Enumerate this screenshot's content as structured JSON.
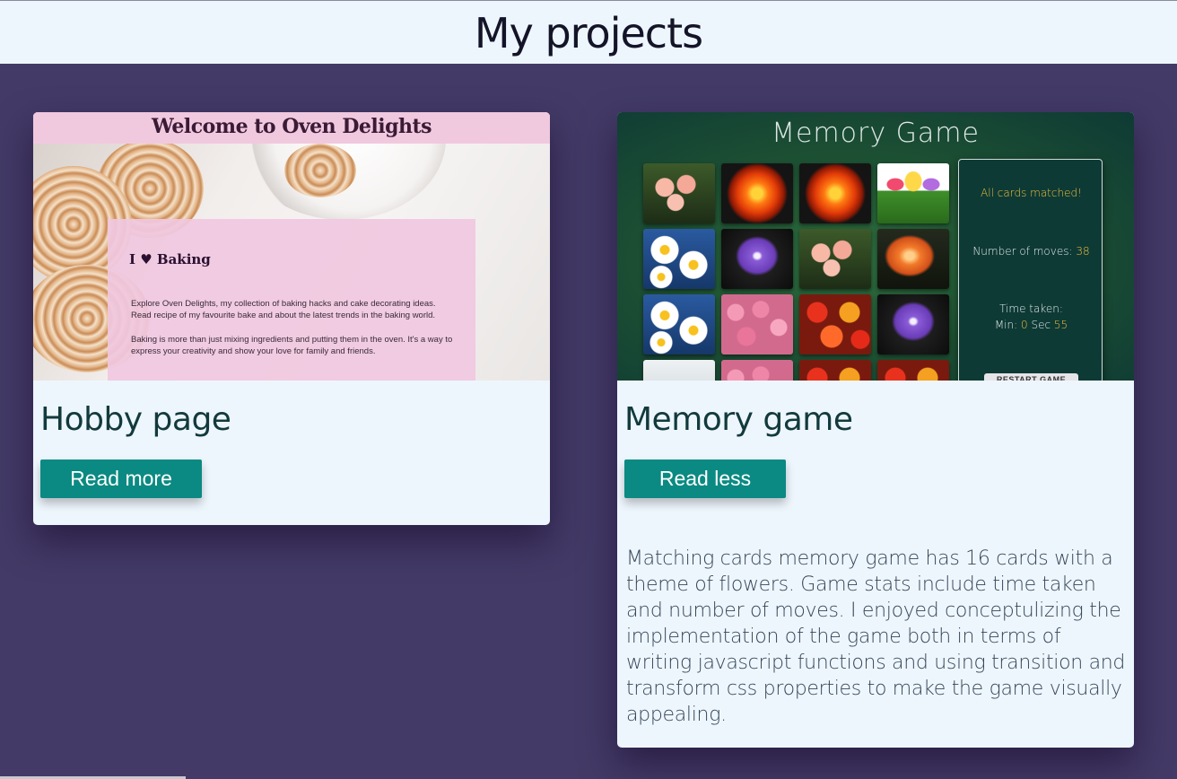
{
  "header": {
    "title": "My projects"
  },
  "projects": [
    {
      "title": "Hobby page",
      "button_label": "Read more",
      "thumbnail": {
        "banner": "Welcome to Oven Delights",
        "heading": "I ♥ Baking",
        "para1": "Explore Oven Delights, my collection of baking hacks and cake decorating ideas. Read recipe of my favourite bake and about the latest trends in the baking world.",
        "para2": "Baking is more than just mixing ingredients and putting them in the oven. It's a way to express your creativity and show your love for family and friends."
      }
    },
    {
      "title": "Memory game",
      "button_label": "Read less",
      "description": "Matching cards memory game has 16 cards with a theme of flowers. Game stats include time taken and number of moves. I enjoyed conceptulizing the implementation of the game both in terms of writing javascript functions and using transition and transform css properties to make the game visually appealing.",
      "thumbnail": {
        "title": "Memory Game",
        "status": "All cards matched!",
        "moves_label": "Number of moves:",
        "moves_value": "38",
        "time_label": "Time taken:",
        "min_label": "Min:",
        "min_value": "0",
        "sec_label": "Sec",
        "sec_value": "55",
        "restart_label": "RESTART GAME",
        "tiles": [
          "orchid",
          "dahlia",
          "dahlia",
          "tulip",
          "daisy",
          "violet",
          "orchid",
          "lily",
          "daisy",
          "roses",
          "mixed",
          "violet",
          "light",
          "roses",
          "mixed",
          "mixed"
        ]
      }
    }
  ],
  "colors": {
    "background": "#433a67",
    "header_bg": "#eef6fd",
    "card_bg": "#eef6fd",
    "button_bg": "#0a8a82",
    "title_text": "#123a3c"
  }
}
